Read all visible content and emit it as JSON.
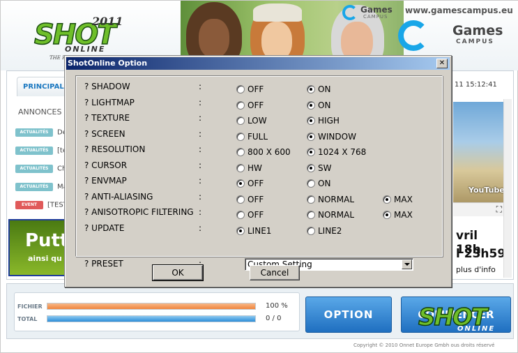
{
  "launcher": {
    "logo": {
      "shot": "SHOT",
      "year": "2011",
      "online": "ONLINE",
      "tagline": "THE FIELD AND MORE..."
    },
    "website": "www.gamescampus.eu",
    "gamescampus": {
      "line1": "Games",
      "line2": "CAMPUS"
    },
    "tab_principal": "PRINCIPAL",
    "datetime": "11 15:12:41",
    "announcements_title": "ANNONCES",
    "news": [
      {
        "badge": "ACTUALITÉS",
        "text": "De",
        "type": "actualites"
      },
      {
        "badge": "ACTUALITÉS",
        "text": "[te",
        "type": "actualites"
      },
      {
        "badge": "ACTUALITÉS",
        "text": "Ch",
        "type": "actualites"
      },
      {
        "badge": "ACTUALITÉS",
        "text": "Ma",
        "type": "actualites"
      },
      {
        "badge": "EVENT",
        "text": "[TEST]",
        "type": "event"
      }
    ],
    "promo_left": {
      "line1": "Putt",
      "line2": "ainsi qu"
    },
    "video": {
      "brand": "YouTube",
      "fullscreen_icon": "fullscreen-icon"
    },
    "promo_right": {
      "line1": "vril 18h",
      "line2": "l 23h59",
      "line3": "plus d'info"
    },
    "progress": [
      {
        "label": "FICHIER",
        "fraction": 1.0,
        "text": "100 %",
        "color": "#f0843c"
      },
      {
        "label": "TOTAL",
        "fraction": 1.0,
        "text": "0 / 0",
        "color": "#2d8ed8"
      }
    ],
    "option_button": "OPTION",
    "commencer_button": "COMMENCER",
    "commencer_logo": {
      "shot": "SHOT",
      "online": "ONLINE"
    },
    "copyright": "Copyright © 2010 Onnet Europe Gmbh ous droits réservé"
  },
  "dialog": {
    "title": "ShotOnline Option",
    "close_label": "✕",
    "options": [
      {
        "label": "? SHADOW",
        "choices": [
          {
            "text": "OFF",
            "checked": false
          },
          {
            "text": "ON",
            "checked": true
          }
        ]
      },
      {
        "label": "? LIGHTMAP",
        "choices": [
          {
            "text": "OFF",
            "checked": false
          },
          {
            "text": "ON",
            "checked": true
          }
        ]
      },
      {
        "label": "? TEXTURE",
        "choices": [
          {
            "text": "LOW",
            "checked": false
          },
          {
            "text": "HIGH",
            "checked": true
          }
        ]
      },
      {
        "label": "? SCREEN",
        "choices": [
          {
            "text": "FULL",
            "checked": false
          },
          {
            "text": "WINDOW",
            "checked": true
          }
        ]
      },
      {
        "label": "? RESOLUTION",
        "choices": [
          {
            "text": "800 X 600",
            "checked": false
          },
          {
            "text": "1024 X 768",
            "checked": true
          }
        ]
      },
      {
        "label": "? CURSOR",
        "choices": [
          {
            "text": "HW",
            "checked": false
          },
          {
            "text": "SW",
            "checked": true
          }
        ]
      },
      {
        "label": "? ENVMAP",
        "choices": [
          {
            "text": "OFF",
            "checked": true
          },
          {
            "text": "ON",
            "checked": false
          }
        ]
      },
      {
        "label": "? ANTI-ALIASING",
        "choices": [
          {
            "text": "OFF",
            "checked": false
          },
          {
            "text": "NORMAL",
            "checked": false
          },
          {
            "text": "MAX",
            "checked": true
          }
        ]
      },
      {
        "label": "? ANISOTROPIC FILTERING",
        "choices": [
          {
            "text": "OFF",
            "checked": false
          },
          {
            "text": "NORMAL",
            "checked": false
          },
          {
            "text": "MAX",
            "checked": true
          }
        ]
      },
      {
        "label": "? UPDATE",
        "choices": [
          {
            "text": "LINE1",
            "checked": true
          },
          {
            "text": "LINE2",
            "checked": false
          }
        ]
      }
    ],
    "preset": {
      "label": "? PRESET",
      "value": "Custom Setting"
    },
    "ok_label": "OK",
    "cancel_label": "Cancel"
  }
}
